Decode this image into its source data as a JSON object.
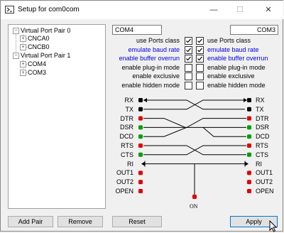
{
  "window": {
    "title": "Setup for com0com",
    "minimize": "—",
    "maximize": "☐",
    "close": "✕"
  },
  "tree": {
    "pair0": "Virtual Port Pair 0",
    "pair0_a": "CNCA0",
    "pair0_b": "CNCB0",
    "pair1": "Virtual Port Pair 1",
    "pair1_a": "COM4",
    "pair1_b": "COM3"
  },
  "ports": {
    "left_name": "COM4",
    "right_name": "COM3"
  },
  "options": [
    {
      "label": "use Ports class",
      "blue": false,
      "left_checked": true,
      "right_checked": true
    },
    {
      "label": "emulate baud rate",
      "blue": true,
      "left_checked": true,
      "right_checked": true
    },
    {
      "label": "enable buffer overrun",
      "blue": true,
      "left_checked": true,
      "right_checked": true
    },
    {
      "label": "enable plug-in mode",
      "blue": false,
      "left_checked": false,
      "right_checked": false
    },
    {
      "label": "enable exclusive",
      "blue": false,
      "left_checked": false,
      "right_checked": false
    },
    {
      "label": "enable hidden mode",
      "blue": false,
      "left_checked": false,
      "right_checked": false
    }
  ],
  "pins": [
    "RX",
    "TX",
    "DTR",
    "DSR",
    "DCD",
    "RTS",
    "CTS",
    "RI",
    "OUT1",
    "OUT2",
    "OPEN"
  ],
  "on_label": "ON",
  "buttons": {
    "add_pair": "Add Pair",
    "remove": "Remove",
    "reset": "Reset",
    "apply": "Apply"
  },
  "colors": {
    "dot_black": "#000000",
    "dot_red": "#e00000",
    "dot_green": "#00a000",
    "link_blue": "#0000e0",
    "apply_border": "#0078d7"
  }
}
